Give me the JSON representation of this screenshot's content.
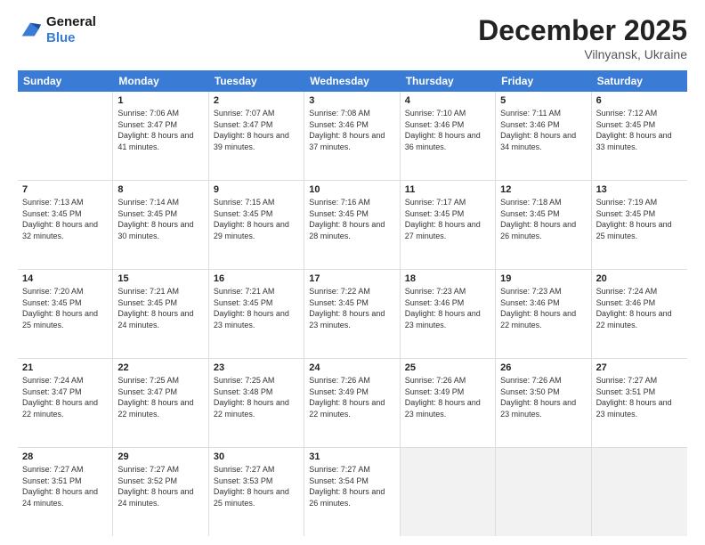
{
  "logo": {
    "line1": "General",
    "line2": "Blue"
  },
  "title": "December 2025",
  "subtitle": "Vilnyansk, Ukraine",
  "header_days": [
    "Sunday",
    "Monday",
    "Tuesday",
    "Wednesday",
    "Thursday",
    "Friday",
    "Saturday"
  ],
  "weeks": [
    [
      {
        "date": "",
        "sunrise": "",
        "sunset": "",
        "daylight": ""
      },
      {
        "date": "1",
        "sunrise": "Sunrise: 7:06 AM",
        "sunset": "Sunset: 3:47 PM",
        "daylight": "Daylight: 8 hours and 41 minutes."
      },
      {
        "date": "2",
        "sunrise": "Sunrise: 7:07 AM",
        "sunset": "Sunset: 3:47 PM",
        "daylight": "Daylight: 8 hours and 39 minutes."
      },
      {
        "date": "3",
        "sunrise": "Sunrise: 7:08 AM",
        "sunset": "Sunset: 3:46 PM",
        "daylight": "Daylight: 8 hours and 37 minutes."
      },
      {
        "date": "4",
        "sunrise": "Sunrise: 7:10 AM",
        "sunset": "Sunset: 3:46 PM",
        "daylight": "Daylight: 8 hours and 36 minutes."
      },
      {
        "date": "5",
        "sunrise": "Sunrise: 7:11 AM",
        "sunset": "Sunset: 3:46 PM",
        "daylight": "Daylight: 8 hours and 34 minutes."
      },
      {
        "date": "6",
        "sunrise": "Sunrise: 7:12 AM",
        "sunset": "Sunset: 3:45 PM",
        "daylight": "Daylight: 8 hours and 33 minutes."
      }
    ],
    [
      {
        "date": "7",
        "sunrise": "Sunrise: 7:13 AM",
        "sunset": "Sunset: 3:45 PM",
        "daylight": "Daylight: 8 hours and 32 minutes."
      },
      {
        "date": "8",
        "sunrise": "Sunrise: 7:14 AM",
        "sunset": "Sunset: 3:45 PM",
        "daylight": "Daylight: 8 hours and 30 minutes."
      },
      {
        "date": "9",
        "sunrise": "Sunrise: 7:15 AM",
        "sunset": "Sunset: 3:45 PM",
        "daylight": "Daylight: 8 hours and 29 minutes."
      },
      {
        "date": "10",
        "sunrise": "Sunrise: 7:16 AM",
        "sunset": "Sunset: 3:45 PM",
        "daylight": "Daylight: 8 hours and 28 minutes."
      },
      {
        "date": "11",
        "sunrise": "Sunrise: 7:17 AM",
        "sunset": "Sunset: 3:45 PM",
        "daylight": "Daylight: 8 hours and 27 minutes."
      },
      {
        "date": "12",
        "sunrise": "Sunrise: 7:18 AM",
        "sunset": "Sunset: 3:45 PM",
        "daylight": "Daylight: 8 hours and 26 minutes."
      },
      {
        "date": "13",
        "sunrise": "Sunrise: 7:19 AM",
        "sunset": "Sunset: 3:45 PM",
        "daylight": "Daylight: 8 hours and 25 minutes."
      }
    ],
    [
      {
        "date": "14",
        "sunrise": "Sunrise: 7:20 AM",
        "sunset": "Sunset: 3:45 PM",
        "daylight": "Daylight: 8 hours and 25 minutes."
      },
      {
        "date": "15",
        "sunrise": "Sunrise: 7:21 AM",
        "sunset": "Sunset: 3:45 PM",
        "daylight": "Daylight: 8 hours and 24 minutes."
      },
      {
        "date": "16",
        "sunrise": "Sunrise: 7:21 AM",
        "sunset": "Sunset: 3:45 PM",
        "daylight": "Daylight: 8 hours and 23 minutes."
      },
      {
        "date": "17",
        "sunrise": "Sunrise: 7:22 AM",
        "sunset": "Sunset: 3:45 PM",
        "daylight": "Daylight: 8 hours and 23 minutes."
      },
      {
        "date": "18",
        "sunrise": "Sunrise: 7:23 AM",
        "sunset": "Sunset: 3:46 PM",
        "daylight": "Daylight: 8 hours and 23 minutes."
      },
      {
        "date": "19",
        "sunrise": "Sunrise: 7:23 AM",
        "sunset": "Sunset: 3:46 PM",
        "daylight": "Daylight: 8 hours and 22 minutes."
      },
      {
        "date": "20",
        "sunrise": "Sunrise: 7:24 AM",
        "sunset": "Sunset: 3:46 PM",
        "daylight": "Daylight: 8 hours and 22 minutes."
      }
    ],
    [
      {
        "date": "21",
        "sunrise": "Sunrise: 7:24 AM",
        "sunset": "Sunset: 3:47 PM",
        "daylight": "Daylight: 8 hours and 22 minutes."
      },
      {
        "date": "22",
        "sunrise": "Sunrise: 7:25 AM",
        "sunset": "Sunset: 3:47 PM",
        "daylight": "Daylight: 8 hours and 22 minutes."
      },
      {
        "date": "23",
        "sunrise": "Sunrise: 7:25 AM",
        "sunset": "Sunset: 3:48 PM",
        "daylight": "Daylight: 8 hours and 22 minutes."
      },
      {
        "date": "24",
        "sunrise": "Sunrise: 7:26 AM",
        "sunset": "Sunset: 3:49 PM",
        "daylight": "Daylight: 8 hours and 22 minutes."
      },
      {
        "date": "25",
        "sunrise": "Sunrise: 7:26 AM",
        "sunset": "Sunset: 3:49 PM",
        "daylight": "Daylight: 8 hours and 23 minutes."
      },
      {
        "date": "26",
        "sunrise": "Sunrise: 7:26 AM",
        "sunset": "Sunset: 3:50 PM",
        "daylight": "Daylight: 8 hours and 23 minutes."
      },
      {
        "date": "27",
        "sunrise": "Sunrise: 7:27 AM",
        "sunset": "Sunset: 3:51 PM",
        "daylight": "Daylight: 8 hours and 23 minutes."
      }
    ],
    [
      {
        "date": "28",
        "sunrise": "Sunrise: 7:27 AM",
        "sunset": "Sunset: 3:51 PM",
        "daylight": "Daylight: 8 hours and 24 minutes."
      },
      {
        "date": "29",
        "sunrise": "Sunrise: 7:27 AM",
        "sunset": "Sunset: 3:52 PM",
        "daylight": "Daylight: 8 hours and 24 minutes."
      },
      {
        "date": "30",
        "sunrise": "Sunrise: 7:27 AM",
        "sunset": "Sunset: 3:53 PM",
        "daylight": "Daylight: 8 hours and 25 minutes."
      },
      {
        "date": "31",
        "sunrise": "Sunrise: 7:27 AM",
        "sunset": "Sunset: 3:54 PM",
        "daylight": "Daylight: 8 hours and 26 minutes."
      },
      {
        "date": "",
        "sunrise": "",
        "sunset": "",
        "daylight": ""
      },
      {
        "date": "",
        "sunrise": "",
        "sunset": "",
        "daylight": ""
      },
      {
        "date": "",
        "sunrise": "",
        "sunset": "",
        "daylight": ""
      }
    ]
  ]
}
